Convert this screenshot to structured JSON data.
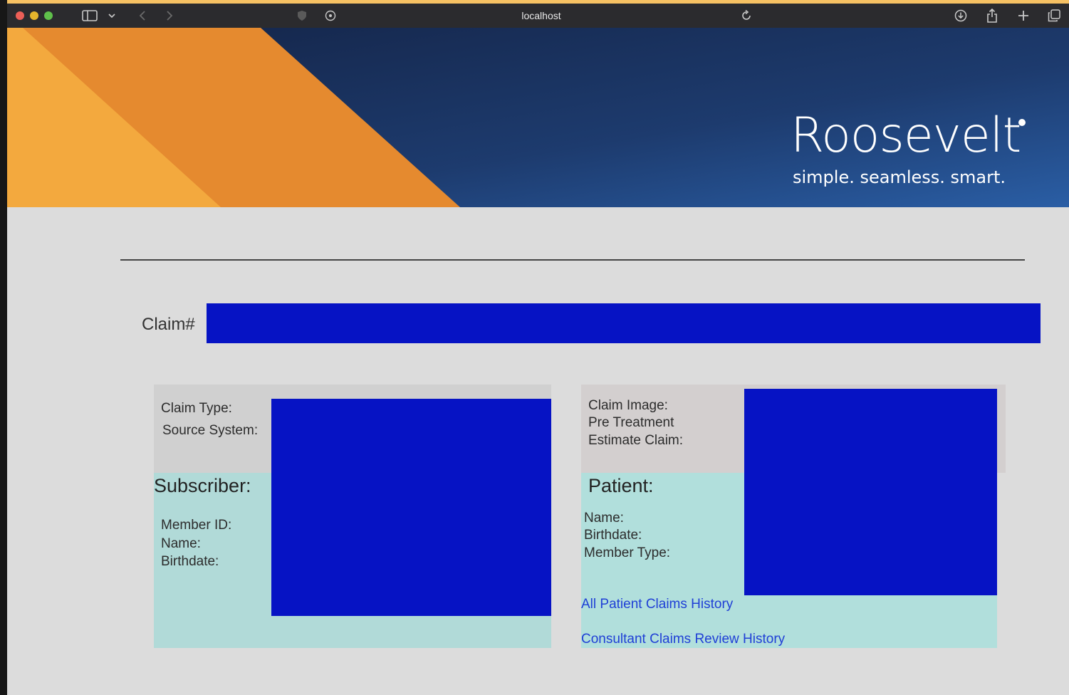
{
  "browser": {
    "url": "localhost"
  },
  "brand": {
    "name": "Roosevelt",
    "tagline": "simple. seamless. smart.",
    "colors": {
      "navy": "#1c3f72",
      "orange": "#e58a2f",
      "light_orange": "#f3a93e"
    }
  },
  "claim": {
    "label": "Claim#",
    "value": ""
  },
  "claim_info": {
    "claim_type_label": "Claim Type:",
    "source_system_label": "Source System:"
  },
  "subscriber": {
    "title": "Subscriber:",
    "member_id_label": "Member ID:",
    "name_label": "Name:",
    "birthdate_label": "Birthdate:"
  },
  "claim_image": {
    "claim_image_label": "Claim Image:",
    "pre_treatment_label": "Pre Treatment",
    "estimate_claim_label": "Estimate Claim:"
  },
  "patient": {
    "title": "Patient:",
    "name_label": "Name:",
    "birthdate_label": "Birthdate:",
    "member_type_label": "Member Type:"
  },
  "links": {
    "all_patient_claims_history": "All Patient Claims History",
    "consultant_claims_review_history": "Consultant Claims Review History"
  },
  "icons": [
    "sidebar-icon",
    "chevron-down-icon",
    "back-icon",
    "forward-icon",
    "shield-icon",
    "privacy-icon",
    "reload-icon",
    "download-icon",
    "share-icon",
    "plus-icon",
    "tabs-icon"
  ]
}
